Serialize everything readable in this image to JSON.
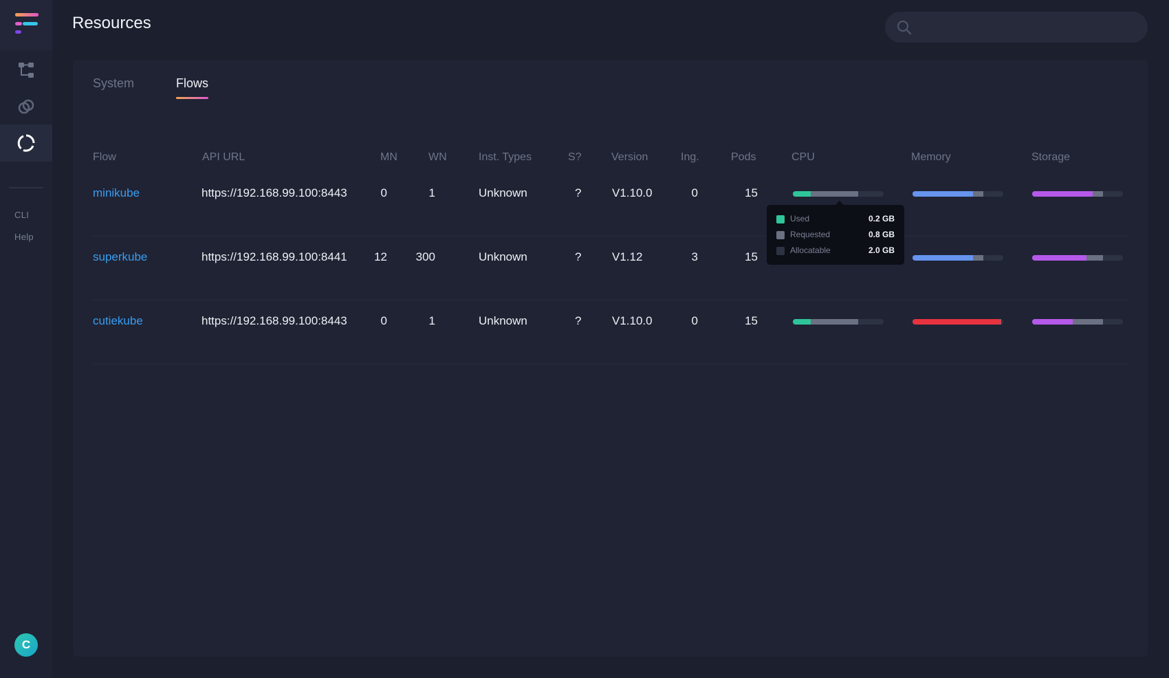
{
  "page": {
    "title": "Resources"
  },
  "search": {
    "placeholder": ""
  },
  "sidebar": {
    "items": [
      {
        "icon": "flow-hierarchy-icon",
        "active": false
      },
      {
        "icon": "link-icon",
        "active": false
      },
      {
        "icon": "resources-ring-icon",
        "active": true
      }
    ],
    "text_links": [
      "CLI",
      "Help"
    ],
    "avatar_initial": "C"
  },
  "tabs": [
    {
      "label": "System",
      "active": false
    },
    {
      "label": "Flows",
      "active": true
    }
  ],
  "table": {
    "columns": [
      "Flow",
      "API URL",
      "MN",
      "WN",
      "Inst. Types",
      "S?",
      "Version",
      "Ing.",
      "Pods",
      "CPU",
      "Memory",
      "Storage"
    ],
    "rows": [
      {
        "flow": "minikube",
        "api_url": "https://192.168.99.100:8443",
        "mn": "0",
        "wn": "1",
        "inst_types": "Unknown",
        "s": "?",
        "version": "V1.10.0",
        "ing": "0",
        "pods": "15",
        "cpu": {
          "used": 0.2,
          "requested": 0.72,
          "color": "#2fc59a"
        },
        "memory": {
          "used": 0.67,
          "requested": 0.78,
          "color": "#6694ee"
        },
        "storage": {
          "used": 0.67,
          "requested": 0.78,
          "color": "#b659ea"
        }
      },
      {
        "flow": "superkube",
        "api_url": "https://192.168.99.100:8441",
        "mn": "12",
        "wn": "300",
        "inst_types": "Unknown",
        "s": "?",
        "version": "V1.12",
        "ing": "3",
        "pods": "15",
        "cpu": {
          "used": 0.2,
          "requested": 0.72,
          "color": "#2fc59a"
        },
        "memory": {
          "used": 0.67,
          "requested": 0.78,
          "color": "#6694ee"
        },
        "storage": {
          "used": 0.6,
          "requested": 0.78,
          "color": "#b659ea"
        }
      },
      {
        "flow": "cutiekube",
        "api_url": "https://192.168.99.100:8443",
        "mn": "0",
        "wn": "1",
        "inst_types": "Unknown",
        "s": "?",
        "version": "V1.10.0",
        "ing": "0",
        "pods": "15",
        "cpu": {
          "used": 0.2,
          "requested": 0.72,
          "color": "#2fc59a"
        },
        "memory": {
          "used": 0.98,
          "requested": 0.98,
          "color": "#e8323f"
        },
        "storage": {
          "used": 0.45,
          "requested": 0.78,
          "color": "#b659ea"
        }
      }
    ]
  },
  "tooltip": {
    "items": [
      {
        "label": "Used",
        "value": "0.2 GB",
        "color": "#2fc59a"
      },
      {
        "label": "Requested",
        "value": "0.8 GB",
        "color": "#6b7082"
      },
      {
        "label": "Allocatable",
        "value": "2.0 GB",
        "color": "#2e3344"
      }
    ]
  }
}
